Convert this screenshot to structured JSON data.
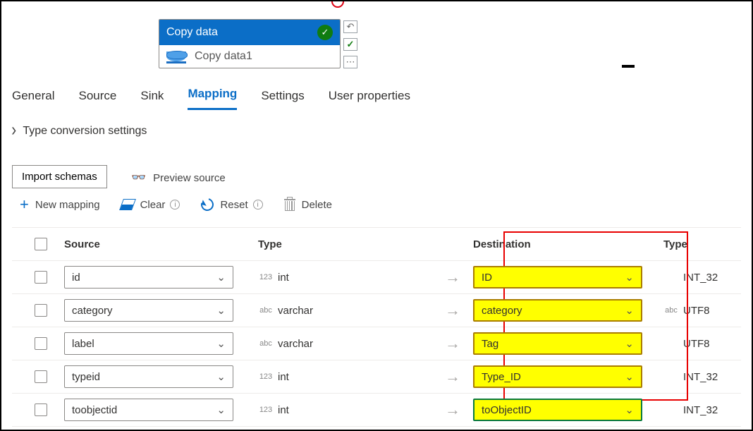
{
  "node": {
    "title": "Copy data",
    "subtitle": "Copy data1"
  },
  "tabs": [
    "General",
    "Source",
    "Sink",
    "Mapping",
    "Settings",
    "User properties"
  ],
  "activeTab": "Mapping",
  "expander": "Type conversion settings",
  "buttons": {
    "importSchemas": "Import schemas",
    "previewSource": "Preview source",
    "newMapping": "New mapping",
    "clear": "Clear",
    "reset": "Reset",
    "delete": "Delete"
  },
  "columns": {
    "source": "Source",
    "type1": "Type",
    "destination": "Destination",
    "type2": "Type"
  },
  "rows": [
    {
      "src": "id",
      "stIcon": "123",
      "stype": "int",
      "dst": "ID",
      "dtIcon": "",
      "dtype": "INT_32",
      "hi": "yellow"
    },
    {
      "src": "category",
      "stIcon": "abc",
      "stype": "varchar",
      "dst": "category",
      "dtIcon": "abc",
      "dtype": "UTF8",
      "hi": "yellow"
    },
    {
      "src": "label",
      "stIcon": "abc",
      "stype": "varchar",
      "dst": "Tag",
      "dtIcon": "",
      "dtype": "UTF8",
      "hi": "yellow"
    },
    {
      "src": "typeid",
      "stIcon": "123",
      "stype": "int",
      "dst": "Type_ID",
      "dtIcon": "",
      "dtype": "INT_32",
      "hi": "yellow"
    },
    {
      "src": "toobjectid",
      "stIcon": "123",
      "stype": "int",
      "dst": "toObjectID",
      "dtIcon": "",
      "dtype": "INT_32",
      "hi": "green"
    }
  ]
}
